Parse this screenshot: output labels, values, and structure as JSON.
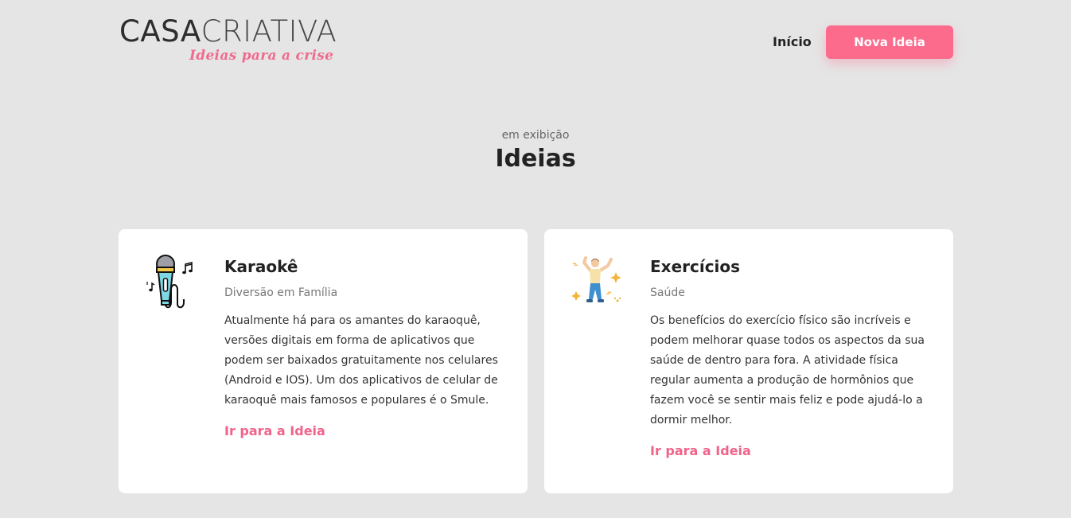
{
  "header": {
    "logo_part1": "CASA",
    "logo_part2": "CRIATIVA",
    "logo_tagline": "Ideias para a crise",
    "nav_home": "Início",
    "nav_new_idea": "Nova Ideia"
  },
  "section": {
    "subtitle": "em exibição",
    "title": "Ideias"
  },
  "ideas": [
    {
      "icon": "microphone-icon",
      "title": "Karaokê",
      "category": "Diversão em Família",
      "description": "Atualmente há para os amantes do karaoquê, versões digitais em forma de aplicativos que podem ser baixados gratuitamente nos celulares (Android e IOS). Um dos aplicativos de celular de karaoquê mais famosos e populares é o Smule.",
      "link": "Ir para a Ideia"
    },
    {
      "icon": "dancing-person-icon",
      "title": "Exercícios",
      "category": "Saúde",
      "description": "Os benefícios do exercício físico são incríveis e podem melhorar quase todos os aspectos da sua saúde de dentro para fora. A atividade física regular aumenta a produção de hormônios que fazem você se sentir mais feliz e pode ajudá-lo a dormir melhor.",
      "link": "Ir para a Ideia"
    }
  ],
  "colors": {
    "accent": "#fc6a8c",
    "background": "#e5e5e5",
    "card": "#ffffff"
  }
}
